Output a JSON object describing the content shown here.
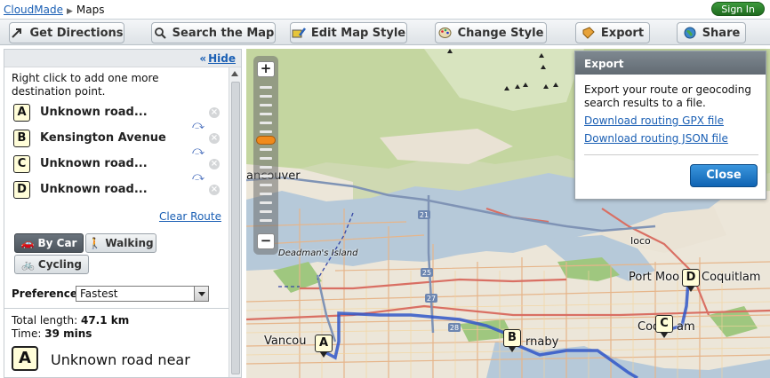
{
  "topbar": {
    "brand": "CloudMade",
    "current": "Maps",
    "signin": "Sign In"
  },
  "toolbar": {
    "get_directions": "Get Directions",
    "search_map": "Search the Map",
    "edit_style": "Edit Map Style",
    "change_style": "Change Style",
    "export": "Export",
    "share": "Share"
  },
  "panel": {
    "hide_arrows": "«",
    "hide": "Hide",
    "hint": "Right click to add one more destination point.",
    "waypoints": [
      {
        "letter": "A",
        "label": "Unknown road..."
      },
      {
        "letter": "B",
        "label": "Kensington Avenue"
      },
      {
        "letter": "C",
        "label": "Unknown road..."
      },
      {
        "letter": "D",
        "label": "Unknown road..."
      }
    ],
    "clear_route": "Clear Route",
    "modes": {
      "car": "By Car",
      "walking": "Walking",
      "cycling": "Cycling"
    },
    "preference_label": "Preference:",
    "preference_value": "Fastest",
    "total_label": "Total length:",
    "total_value": "47.1 km",
    "time_label": "Time:",
    "time_value": "39 mins",
    "first_step_letter": "A",
    "first_step_text": "Unknown road near"
  },
  "map": {
    "labels": {
      "vancouver_top": "ancouver",
      "deadmans_island": "Deadman's Island",
      "ioco": "Ioco",
      "port_moody": "Port Moo",
      "coquitlam": "Coquitlam",
      "vancouver_bottom": "Vancou",
      "burnaby": "rnaby",
      "coquitlam_center": "Coq",
      "coquitlam_center_end": "am"
    },
    "road_shields": [
      "21",
      "25",
      "27",
      "28"
    ],
    "pins": [
      "A",
      "B",
      "C",
      "D"
    ],
    "zoom_in": "+",
    "zoom_out": "−"
  },
  "export_popup": {
    "title": "Export",
    "description": "Export your route or geocoding search results to a file.",
    "gpx_link": "Download routing GPX file",
    "json_link": "Download routing JSON file",
    "close": "Close"
  }
}
